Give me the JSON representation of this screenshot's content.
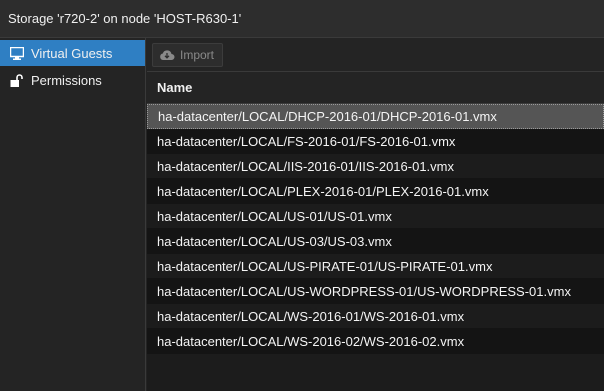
{
  "window": {
    "title": "Storage 'r720-2' on node 'HOST-R630-1'"
  },
  "sidebar": {
    "items": [
      {
        "label": "Virtual Guests",
        "icon": "monitor-icon",
        "active": true
      },
      {
        "label": "Permissions",
        "icon": "unlock-icon",
        "active": false
      }
    ]
  },
  "toolbar": {
    "import_label": "Import",
    "import_icon": "cloud-download-icon"
  },
  "table": {
    "column_header": "Name",
    "rows": [
      "ha-datacenter/LOCAL/DHCP-2016-01/DHCP-2016-01.vmx",
      "ha-datacenter/LOCAL/FS-2016-01/FS-2016-01.vmx",
      "ha-datacenter/LOCAL/IIS-2016-01/IIS-2016-01.vmx",
      "ha-datacenter/LOCAL/PLEX-2016-01/PLEX-2016-01.vmx",
      "ha-datacenter/LOCAL/US-01/US-01.vmx",
      "ha-datacenter/LOCAL/US-03/US-03.vmx",
      "ha-datacenter/LOCAL/US-PIRATE-01/US-PIRATE-01.vmx",
      "ha-datacenter/LOCAL/US-WORDPRESS-01/US-WORDPRESS-01.vmx",
      "ha-datacenter/LOCAL/WS-2016-01/WS-2016-01.vmx",
      "ha-datacenter/LOCAL/WS-2016-02/WS-2016-02.vmx"
    ],
    "selected_index": 0
  },
  "colors": {
    "accent": "#2f7fc3",
    "background": "#1c1c1c",
    "selected_row": "#555555"
  }
}
